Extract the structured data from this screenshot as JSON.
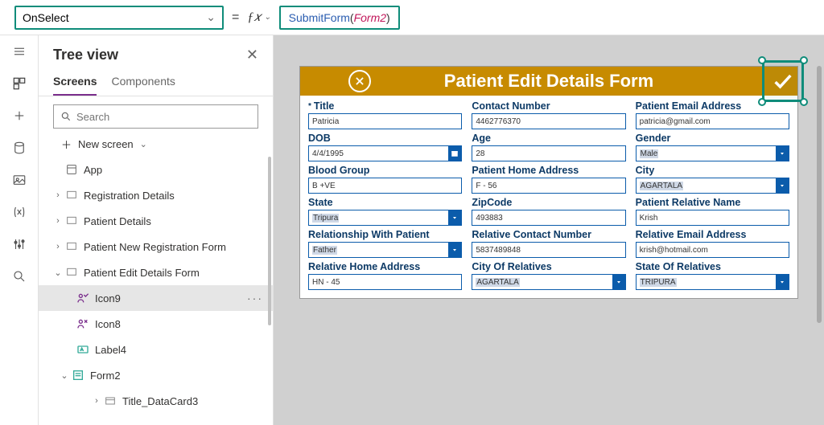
{
  "formula_bar": {
    "property": "OnSelect",
    "fn": "SubmitForm",
    "arg": "Form2"
  },
  "tree": {
    "title": "Tree view",
    "tabs": {
      "screens": "Screens",
      "components": "Components"
    },
    "search_placeholder": "Search",
    "new_screen": "New screen",
    "items": {
      "app": "App",
      "reg": "Registration Details",
      "patient": "Patient Details",
      "newreg": "Patient New Registration Form",
      "editform": "Patient Edit Details Form",
      "icon9": "Icon9",
      "icon8": "Icon8",
      "label4": "Label4",
      "form2": "Form2",
      "dc3": "Title_DataCard3"
    }
  },
  "form": {
    "title": "Patient Edit Details Form",
    "fields": {
      "title": {
        "label": "Title",
        "value": "Patricia"
      },
      "contact": {
        "label": "Contact Number",
        "value": "4462776370"
      },
      "email": {
        "label": "Patient Email Address",
        "value": "patricia@gmail.com"
      },
      "dob": {
        "label": "DOB",
        "value": "4/4/1995"
      },
      "age": {
        "label": "Age",
        "value": "28"
      },
      "gender": {
        "label": "Gender",
        "value": "Male"
      },
      "blood": {
        "label": "Blood Group",
        "value": "B +VE"
      },
      "homeaddr": {
        "label": "Patient Home Address",
        "value": "F - 56"
      },
      "city": {
        "label": "City",
        "value": "AGARTALA"
      },
      "state": {
        "label": "State",
        "value": "Tripura"
      },
      "zip": {
        "label": "ZipCode",
        "value": "493883"
      },
      "relname": {
        "label": "Patient Relative Name",
        "value": "Krish"
      },
      "relation": {
        "label": "Relationship With Patient",
        "value": "Father"
      },
      "relcontact": {
        "label": "Relative Contact Number",
        "value": "5837489848"
      },
      "relemail": {
        "label": "Relative Email Address",
        "value": "krish@hotmail.com"
      },
      "relhome": {
        "label": "Relative Home Address",
        "value": "HN - 45"
      },
      "relcity": {
        "label": "City Of Relatives",
        "value": "AGARTALA"
      },
      "relstate": {
        "label": "State Of Relatives",
        "value": "TRIPURA"
      }
    }
  }
}
